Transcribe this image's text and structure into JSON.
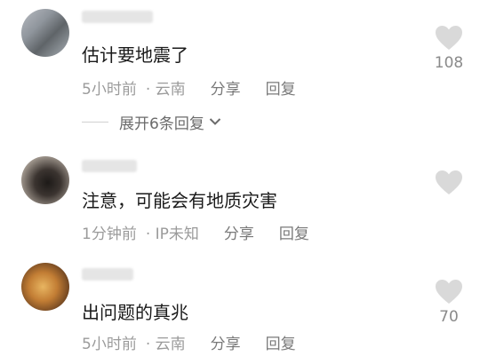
{
  "comments": [
    {
      "content": "估计要地震了",
      "time": "5小时前",
      "location": "· 云南",
      "reply_label": "分享",
      "reply2_label": "回复",
      "likes": "108"
    },
    {
      "content": "注意，可能会有地质灾害",
      "time": "1分钟前",
      "location": "· IP未知",
      "reply_label": "分享",
      "reply2_label": "回复",
      "likes": ""
    },
    {
      "content": "出问题的真兆",
      "time": "5小时前",
      "location": "· 云南",
      "reply_label": "分享",
      "reply2_label": "回复",
      "likes": "70"
    }
  ],
  "expand_replies": "展开6条回复",
  "icons": {
    "like": "heart-icon",
    "expand": "chevron-down-icon"
  },
  "colors": {
    "heart": "#d9d9d9",
    "meta": "#9b9b9b",
    "text": "#1a1a1a"
  }
}
